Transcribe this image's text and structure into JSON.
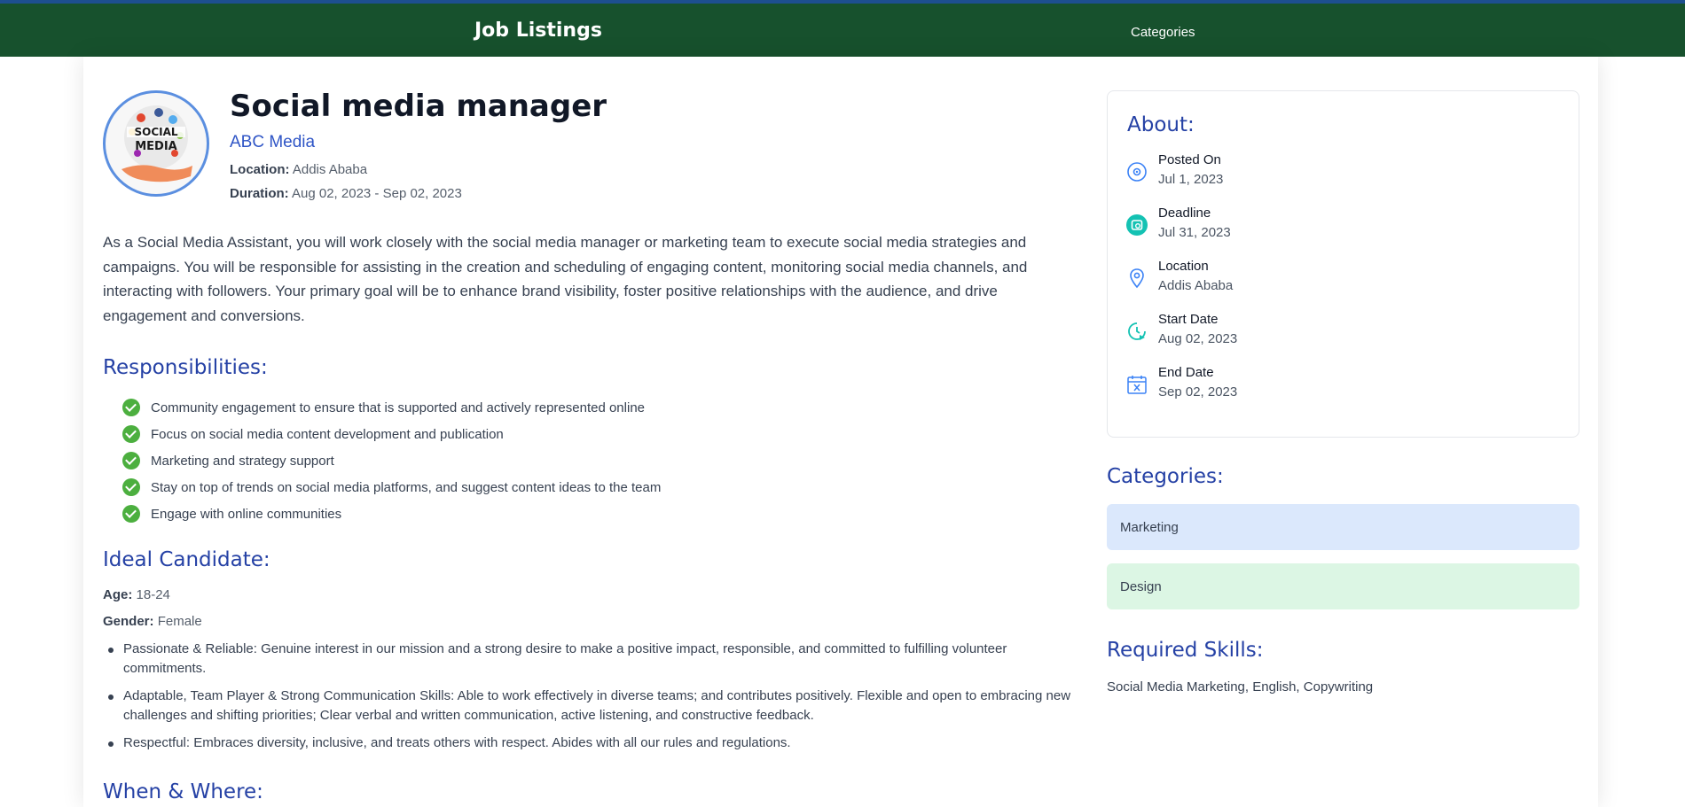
{
  "navbar": {
    "title": "Job Listings",
    "categories_link": "Categories"
  },
  "job": {
    "logo_alt": "SOCIAL MEDIA",
    "title": "Social media manager",
    "company": "ABC Media",
    "location_label": "Location:",
    "location": "Addis Ababa",
    "duration_label": "Duration:",
    "duration": "Aug 02, 2023 - Sep 02, 2023",
    "description": "As a Social Media Assistant, you will work closely with the social media manager or marketing team to execute social media strategies and campaigns. You will be responsible for assisting in the creation and scheduling of engaging content, monitoring social media channels, and interacting with followers. Your primary goal will be to enhance brand visibility, foster positive relationships with the audience, and drive engagement and conversions."
  },
  "responsibilities": {
    "heading": "Responsibilities:",
    "items": [
      "Community engagement to ensure that is supported and actively represented online",
      "Focus on social media content development and publication",
      "Marketing and strategy support",
      "Stay on top of trends on social media platforms, and suggest content ideas to the team",
      "Engage with online communities"
    ]
  },
  "ideal_candidate": {
    "heading": "Ideal Candidate:",
    "age_label": "Age:",
    "age": "18-24",
    "gender_label": "Gender:",
    "gender": "Female",
    "traits": [
      "Passionate & Reliable: Genuine interest in our mission and a strong desire to make a positive impact, responsible, and committed to fulfilling volunteer commitments.",
      "Adaptable, Team Player & Strong Communication Skills: Able to work effectively in diverse teams; and contributes positively. Flexible and open to embracing new challenges and shifting priorities; Clear verbal and written communication, active listening, and constructive feedback.",
      "Respectful: Embraces diversity, inclusive, and treats others with respect. Abides with all our rules and regulations."
    ]
  },
  "when_where": {
    "heading": "When & Where:"
  },
  "about": {
    "heading": "About:",
    "rows": [
      {
        "label": "Posted On",
        "value": "Jul 1, 2023",
        "icon": "posted-icon"
      },
      {
        "label": "Deadline",
        "value": "Jul 31, 2023",
        "icon": "deadline-icon"
      },
      {
        "label": "Location",
        "value": "Addis Ababa",
        "icon": "location-pin-icon"
      },
      {
        "label": "Start Date",
        "value": "Aug 02, 2023",
        "icon": "start-date-icon"
      },
      {
        "label": "End Date",
        "value": "Sep 02, 2023",
        "icon": "end-date-calendar-icon"
      }
    ]
  },
  "categories": {
    "heading": "Categories:",
    "items": [
      "Marketing",
      "Design"
    ]
  },
  "skills": {
    "heading": "Required Skills:",
    "text": "Social Media Marketing, English, Copywriting"
  },
  "colors": {
    "navbar": "#17512d",
    "heading_blue": "#2541a5",
    "company_blue": "#2f55c6",
    "check_green": "#4caf3f",
    "chip_marketing": "#dbe8fc",
    "chip_design": "#dcf6e4",
    "teal_icon": "#14c2b3"
  }
}
